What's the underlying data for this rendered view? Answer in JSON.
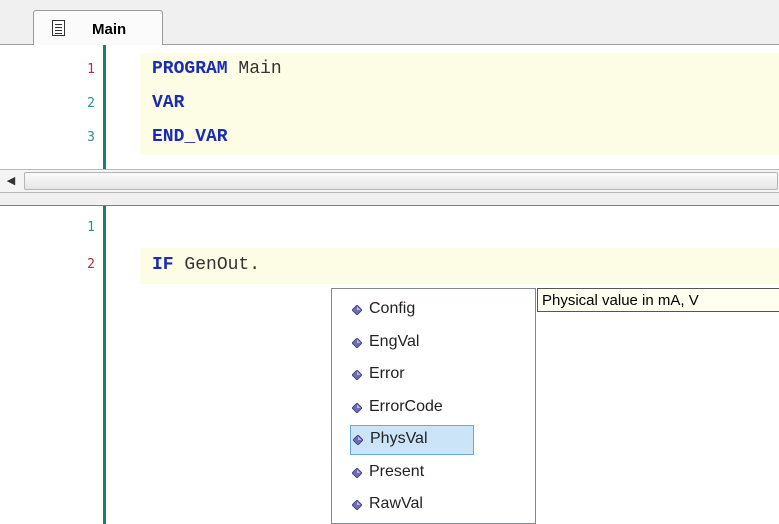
{
  "editor": {
    "tab": {
      "label": "Main",
      "icon": "document-icon"
    },
    "declaration": {
      "lines": [
        {
          "num": "1",
          "keyword": "PROGRAM",
          "rest": " Main"
        },
        {
          "num": "2",
          "keyword": "VAR",
          "rest": ""
        },
        {
          "num": "3",
          "keyword": "END_VAR",
          "rest": ""
        }
      ]
    },
    "implementation": {
      "lines": [
        {
          "num": "1",
          "keyword": "",
          "rest": ""
        },
        {
          "num": "2",
          "keyword": "IF",
          "rest": " GenOut."
        }
      ]
    }
  },
  "completion": {
    "items": [
      "Config",
      "EngVal",
      "Error",
      "ErrorCode",
      "PhysVal",
      "Present",
      "RawVal"
    ],
    "selected": "PhysVal",
    "item_icon": "member-icon",
    "tooltip": "Physical value in mA, V"
  },
  "colors": {
    "keyword": "#1a2db0",
    "line_number_current": "#c0282f",
    "line_number": "#2a8f8f",
    "gutter": "#158076",
    "selection": "#cce4f7"
  }
}
